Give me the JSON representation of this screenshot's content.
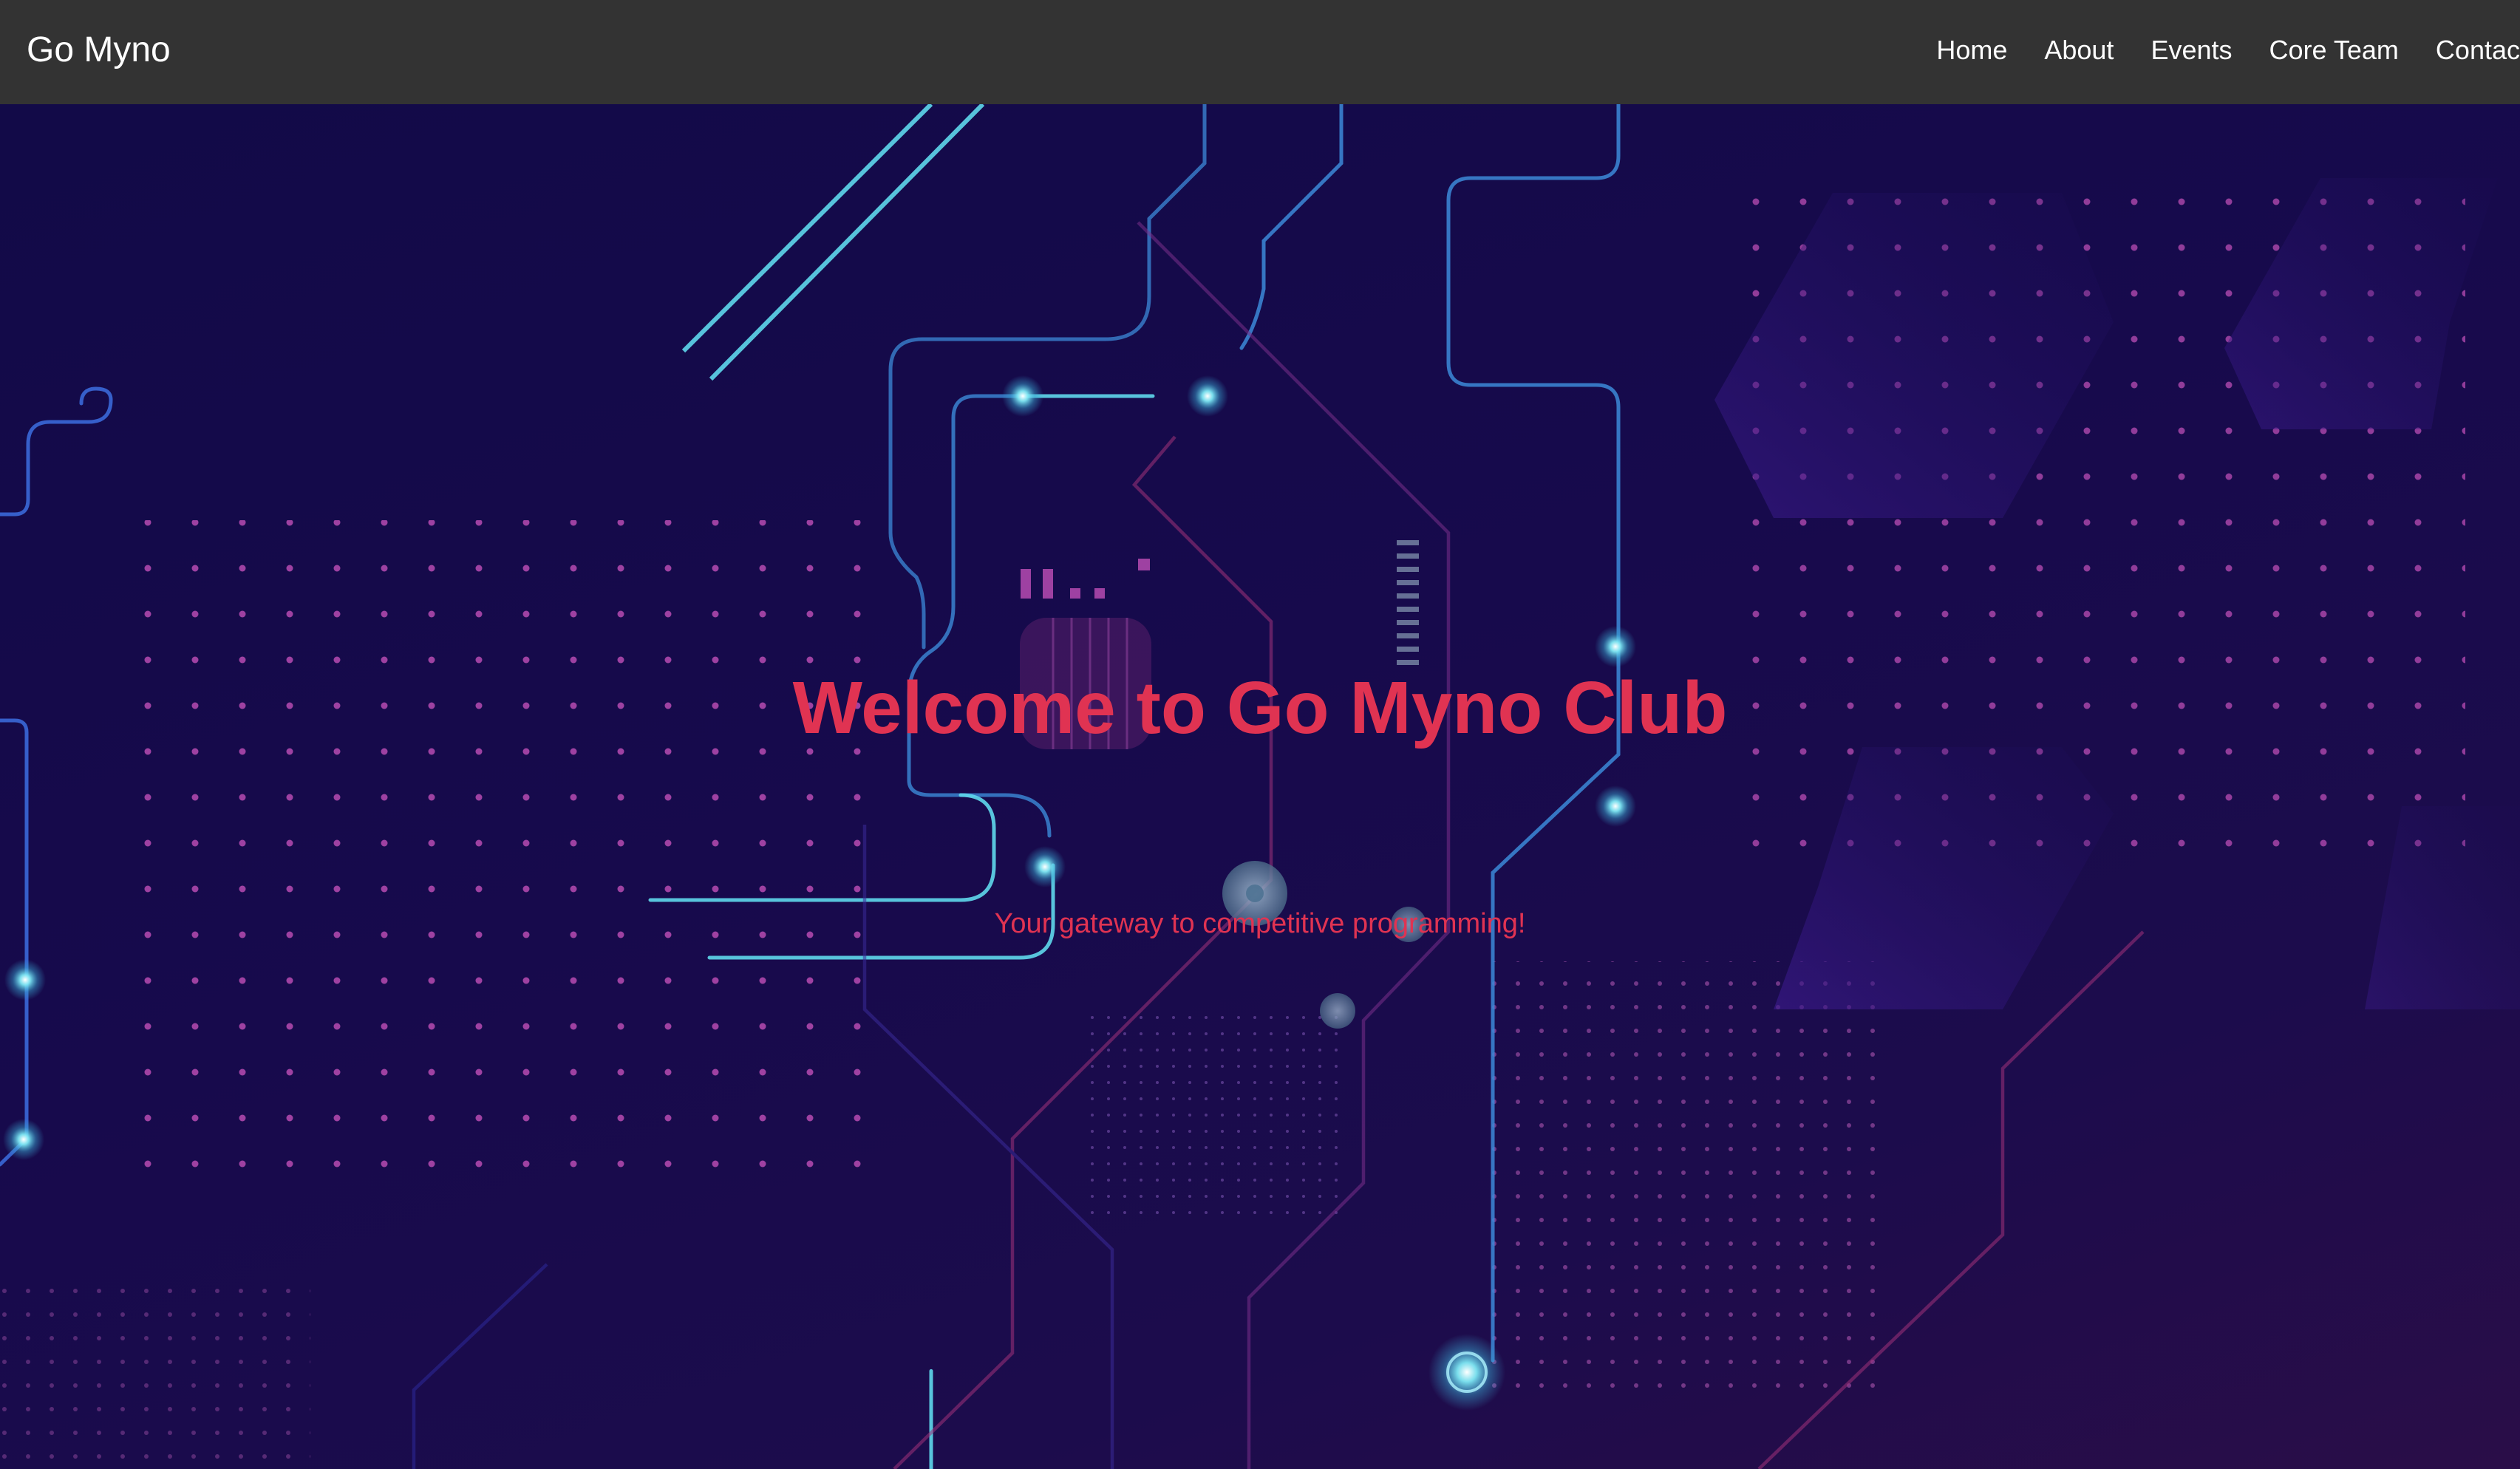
{
  "navbar": {
    "brand": "Go Myno",
    "links": [
      "Home",
      "About",
      "Events",
      "Core Team",
      "Contact"
    ]
  },
  "hero": {
    "title": "Welcome to Go Myno Club",
    "subtitle": "Your gateway to competitive programming!",
    "background_image": "circuit-board-illustration"
  },
  "colors": {
    "navbar_bg": "#333333",
    "nav_text": "#ffffff",
    "hero_bg": "#150a45",
    "accent": "#e03352",
    "circuit_cyan": "#5fd8ec",
    "circuit_blue": "#3c6fe0",
    "dot_pink": "#c04fb8"
  }
}
